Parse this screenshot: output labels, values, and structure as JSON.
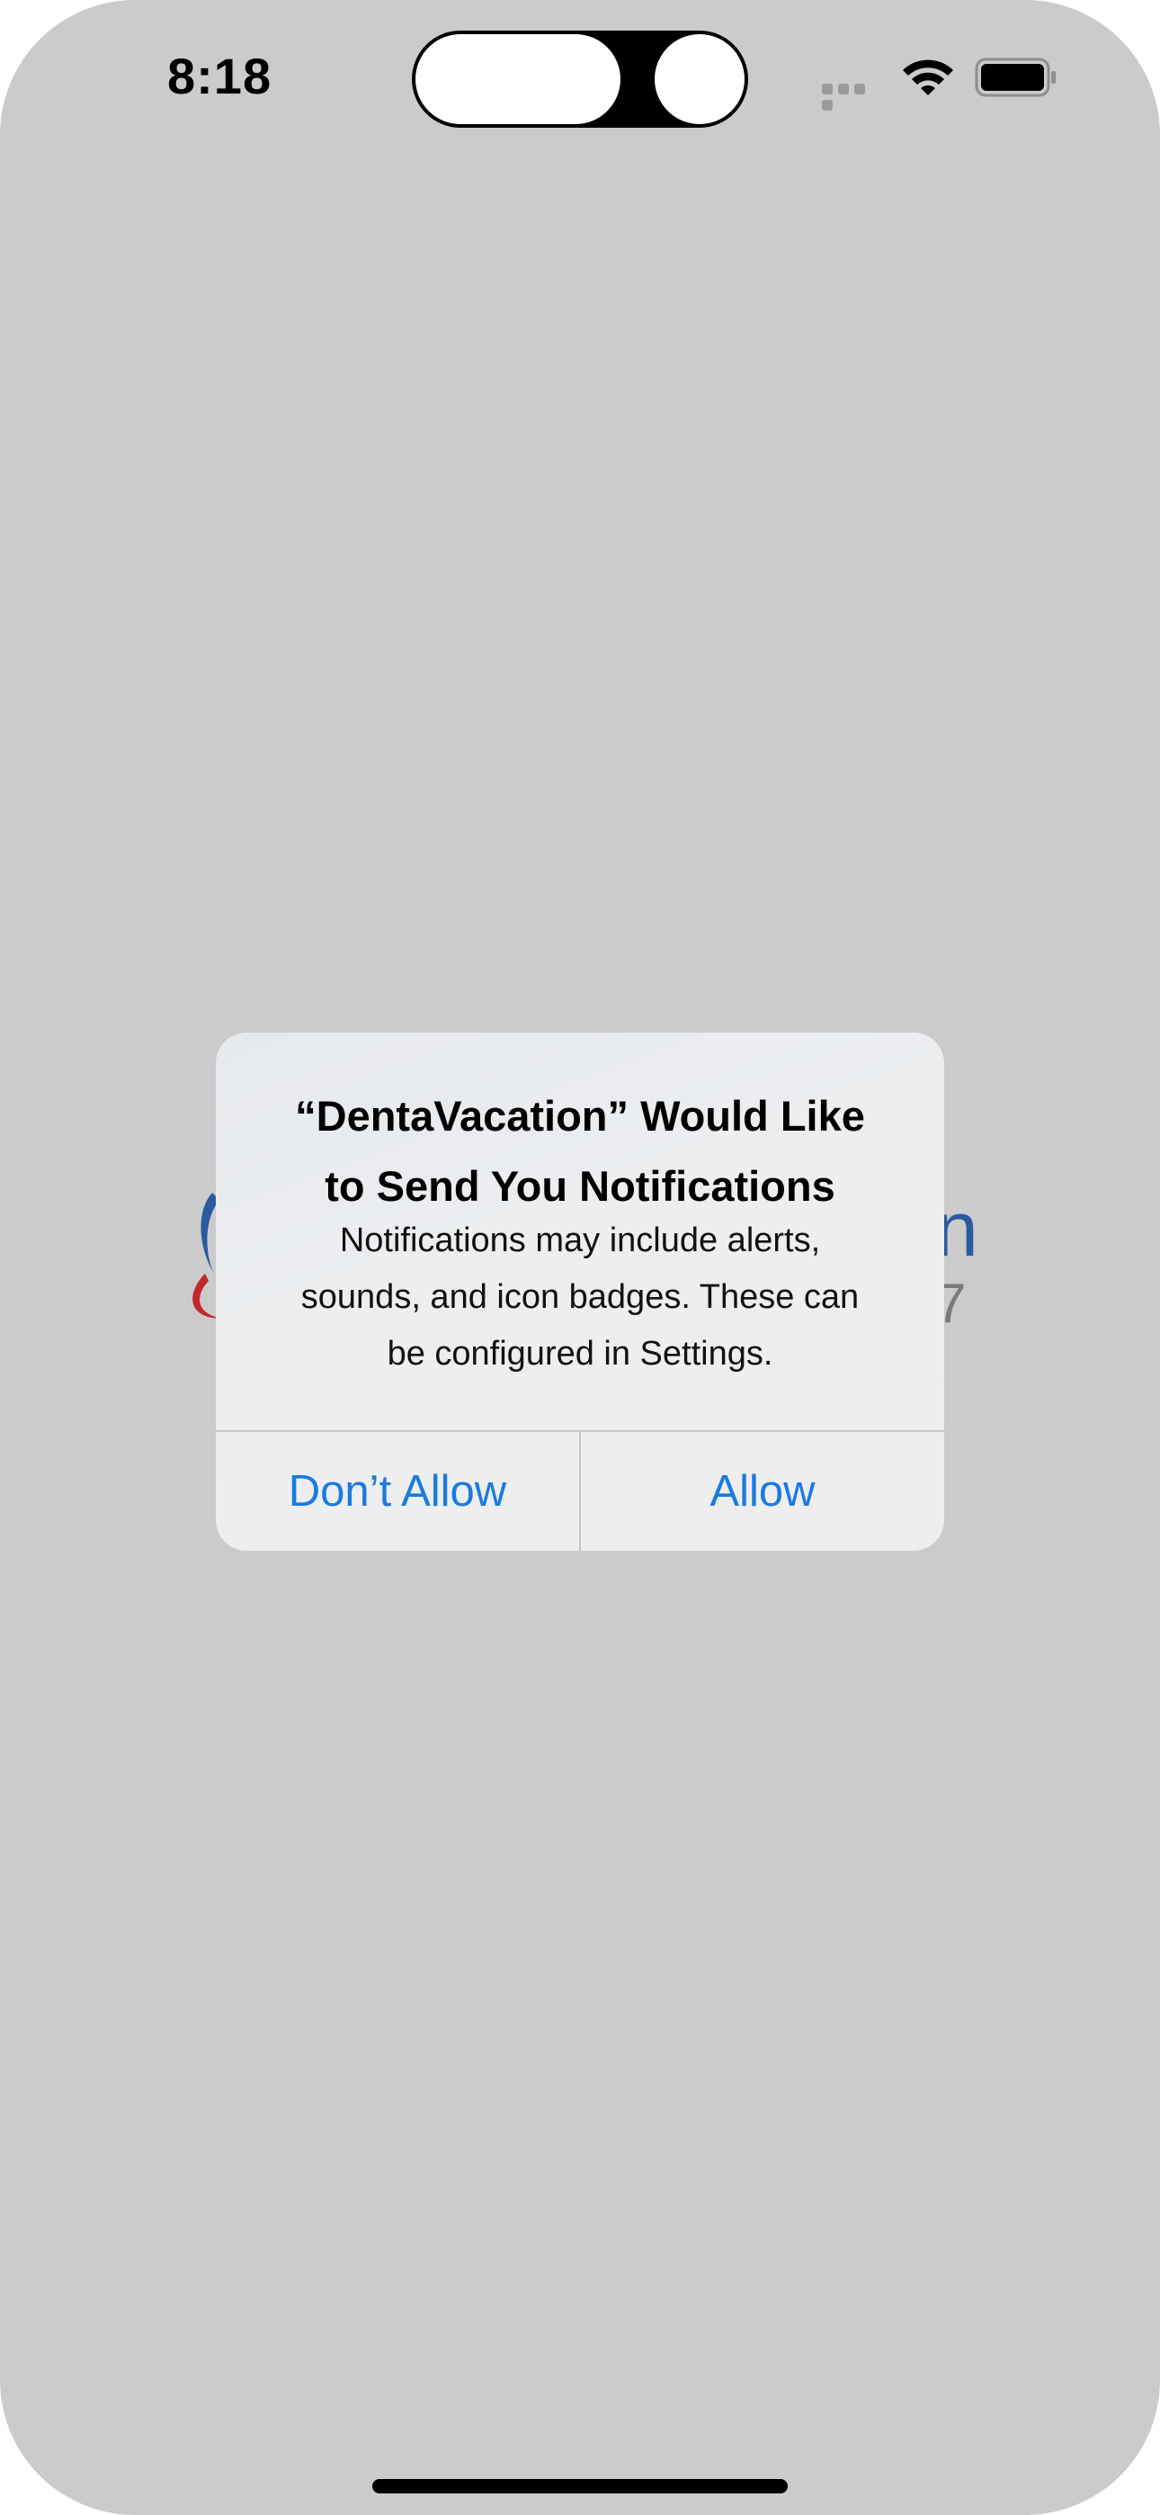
{
  "status_bar": {
    "time": "8:18"
  },
  "background_logo": {
    "text_fragment": "n",
    "digit_fragment": "7",
    "accent_blue": "#2b5aa0",
    "accent_red": "#c0282d"
  },
  "alert": {
    "title_line1": "“DentaVacation” Would Like",
    "title_line2": "to Send You Notifications",
    "message_line1": "Notifications may include alerts,",
    "message_line2": "sounds, and icon badges. These can",
    "message_line3": "be configured in Settings.",
    "dont_allow_label": "Don’t Allow",
    "allow_label": "Allow",
    "button_color": "#1a7ae0"
  },
  "icons": {
    "wifi": "wifi-icon",
    "battery": "battery-icon",
    "signal": "cellular-signal-icon"
  }
}
